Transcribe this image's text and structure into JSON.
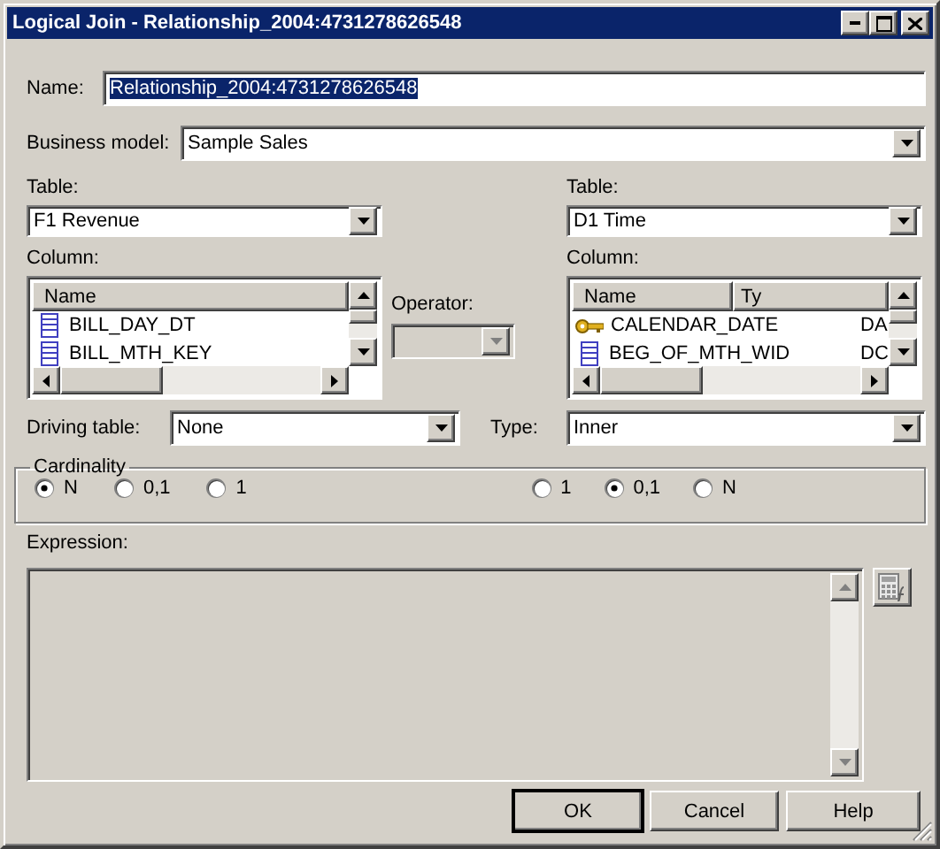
{
  "window": {
    "title": "Logical Join - Relationship_2004:4731278626548"
  },
  "name": {
    "label": "Name:",
    "value": "Relationship_2004:4731278626548",
    "selected": true
  },
  "business_model": {
    "label": "Business model:",
    "value": "Sample Sales"
  },
  "left": {
    "table_label": "Table:",
    "table": "F1 Revenue",
    "column_label": "Column:",
    "headers": [
      "Name"
    ],
    "rows": [
      {
        "kind": "column",
        "name": "BILL_DAY_DT"
      },
      {
        "kind": "column",
        "name": "BILL_MTH_KEY"
      }
    ]
  },
  "operator": {
    "label": "Operator:",
    "disabled": true
  },
  "right": {
    "table_label": "Table:",
    "table": "D1 Time",
    "column_label": "Column:",
    "headers": [
      "Name",
      "Ty"
    ],
    "rows": [
      {
        "kind": "key",
        "name": "CALENDAR_DATE",
        "type": "DA"
      },
      {
        "kind": "column",
        "name": "BEG_OF_MTH_WID",
        "type": "DC"
      }
    ]
  },
  "driving_table": {
    "label": "Driving table:",
    "value": "None"
  },
  "type": {
    "label": "Type:",
    "value": "Inner"
  },
  "cardinality": {
    "legend": "Cardinality",
    "left": [
      {
        "label": "N",
        "selected": true
      },
      {
        "label": "0,1",
        "selected": false
      },
      {
        "label": "1",
        "selected": false
      }
    ],
    "right": [
      {
        "label": "1",
        "selected": false
      },
      {
        "label": "0,1",
        "selected": true
      },
      {
        "label": "N",
        "selected": false
      }
    ]
  },
  "expression": {
    "label": "Expression:"
  },
  "buttons": [
    {
      "label": "OK",
      "default": true
    },
    {
      "label": "Cancel",
      "default": false
    },
    {
      "label": "Help",
      "default": false
    }
  ]
}
